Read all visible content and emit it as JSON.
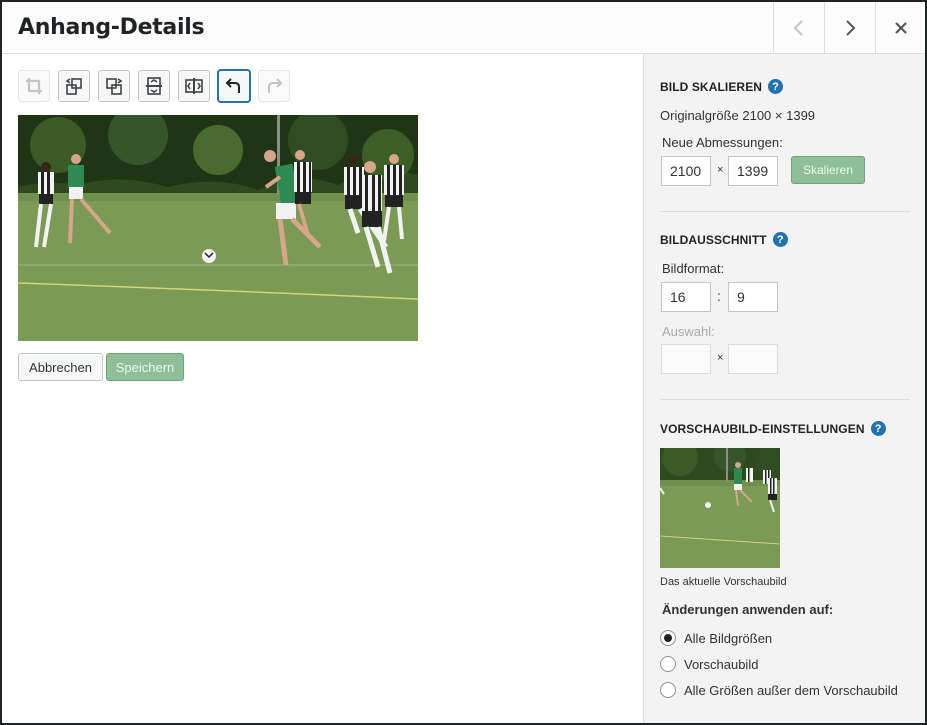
{
  "header": {
    "title": "Anhang-Details",
    "prev_icon": "chevron-left-icon",
    "next_icon": "chevron-right-icon",
    "close_icon": "close-icon"
  },
  "toolbar": {
    "buttons": [
      "crop",
      "rotate-left",
      "rotate-right",
      "flip-vertical",
      "flip-horizontal",
      "undo",
      "redo"
    ]
  },
  "actions": {
    "cancel_label": "Abbrechen",
    "save_label": "Speichern"
  },
  "scale": {
    "title": "Bild skalieren",
    "original_size": "Originalgröße 2100 × 1399",
    "new_dims_label": "Neue Abmessungen:",
    "width": "2100",
    "height": "1399",
    "times": "×",
    "button_label": "Skalieren"
  },
  "crop": {
    "title": "Bildausschnitt",
    "ratio_label": "Bildformat:",
    "ratio_w": "16",
    "ratio_sep": ":",
    "ratio_h": "9",
    "selection_label": "Auswahl:",
    "sel_w": "",
    "sel_h": "",
    "times": "×"
  },
  "thumbnail": {
    "title": "Vorschaubild-Einstellungen",
    "caption": "Das aktuelle Vorschaubild",
    "apply_label": "Änderungen anwenden auf:",
    "options": [
      {
        "label": "Alle Bildgrößen",
        "checked": true
      },
      {
        "label": "Vorschaubild",
        "checked": false
      },
      {
        "label": "Alle Größen außer dem Vorschaubild",
        "checked": false
      }
    ]
  },
  "help_glyph": "?",
  "colors": {
    "accent": "#2271b1",
    "primary_button_disabled": "#8fbf97"
  }
}
